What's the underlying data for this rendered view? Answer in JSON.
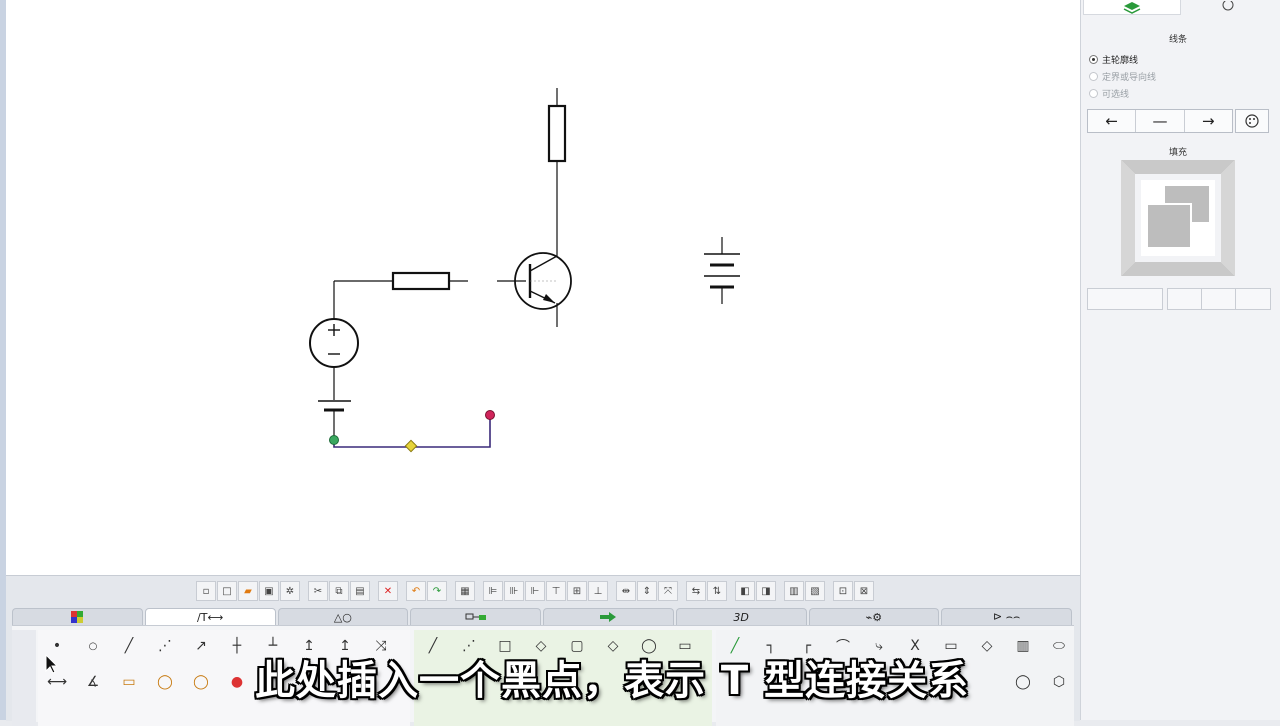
{
  "right_panel": {
    "line_section_title": "线条",
    "radio_options": [
      {
        "label": "主轮廓线",
        "selected": true,
        "enabled": true
      },
      {
        "label": "定界或导向线",
        "selected": false,
        "enabled": false
      },
      {
        "label": "可选线",
        "selected": false,
        "enabled": false
      }
    ],
    "line_buttons": [
      "←",
      "—",
      "→"
    ],
    "fill_section_title": "填充"
  },
  "toolbar": {
    "tab_labels": [
      "",
      "∕T⟷",
      "△○",
      "",
      "",
      "3D",
      "",
      ""
    ]
  },
  "subtitle": {
    "text": "此处插入一个黑点，表示 T 型连接关系"
  },
  "colors": {
    "accent_green": "#2a9a3a",
    "endpoint_red": "#d0245a",
    "endpoint_green": "#3aa860",
    "midpoint_yellow": "#e6d33a",
    "wire_purple": "#3a2a7a"
  },
  "icons": {
    "panel_tab_layers": "layers-icon",
    "panel_tab_palette": "palette-icon",
    "draw_tool_dot": "dot-icon",
    "cursor": "arrow-cursor-icon"
  }
}
